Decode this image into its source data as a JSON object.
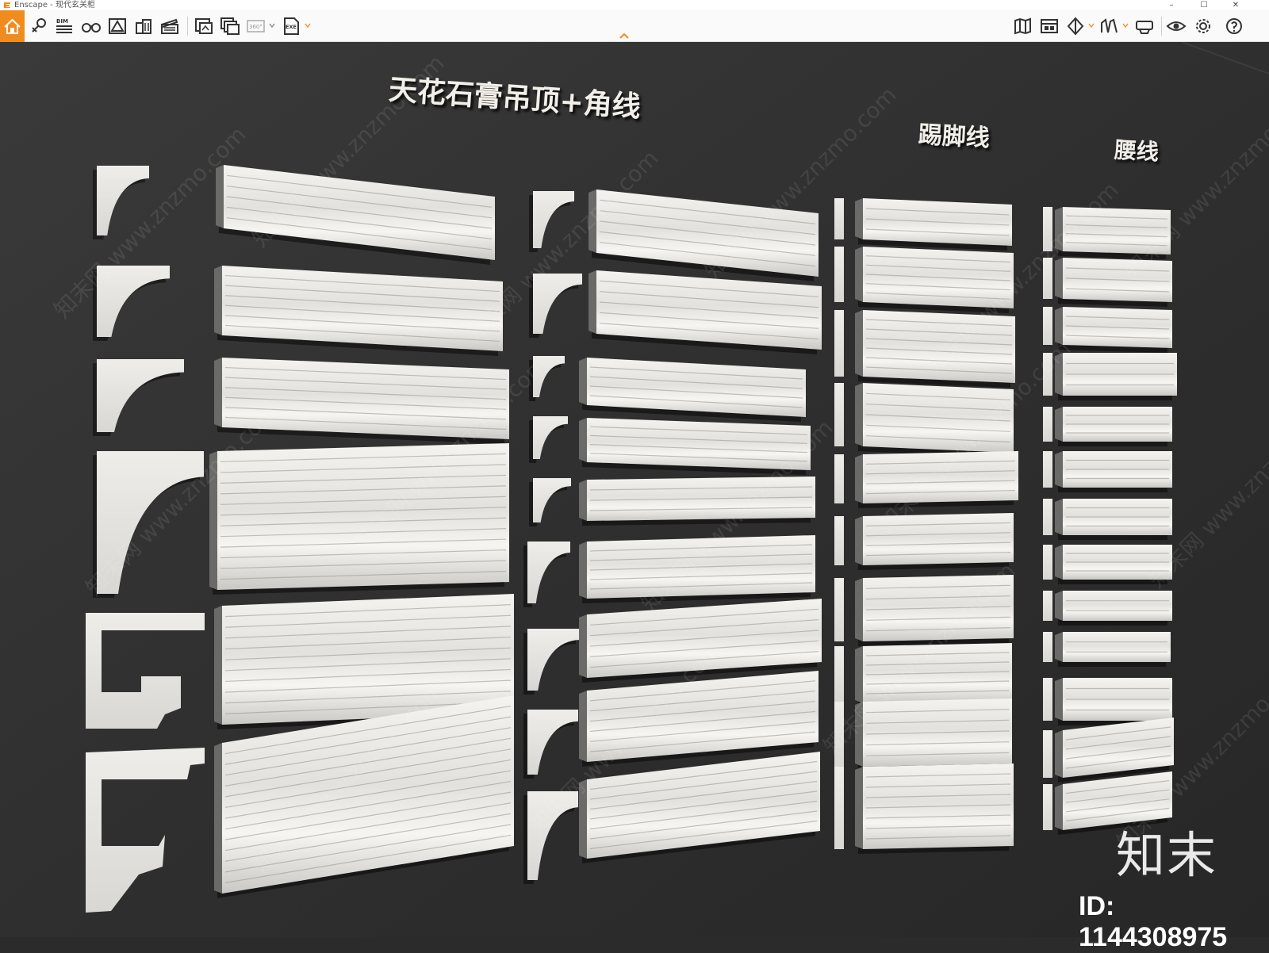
{
  "window": {
    "app_title": "Enscape - 现代玄关柜",
    "minimize_glyph": "–",
    "maximize_glyph": "☐",
    "close_glyph": "✕"
  },
  "toolbar": {
    "accent_color": "#f08c1e",
    "left_tools": [
      "home-icon",
      "pin-icon",
      "bim-icon",
      "binoculars-icon",
      "scene-icon",
      "buildings-icon",
      "clapper-icon",
      "screenshot-icon",
      "batch-render-icon",
      "panorama-360-icon",
      "export-exe-icon"
    ],
    "right_tools": [
      "map-icon",
      "asset-library-icon",
      "visual-settings-icon",
      "collab-icon",
      "vr-icon",
      "visibility-icon",
      "settings-icon",
      "help-icon"
    ],
    "bim_label": "BIM",
    "pano_label": "360°",
    "exe_label": "EXE",
    "collapse_icon": "chevron-up-icon"
  },
  "scene": {
    "title_ceiling": "天花石膏吊顶+角线",
    "title_skirting": "踢脚线",
    "title_waist": "腰线",
    "brand": "知末",
    "model_id": "ID: 1144308975",
    "watermark_text": "知末网 www.znzmo.com"
  }
}
